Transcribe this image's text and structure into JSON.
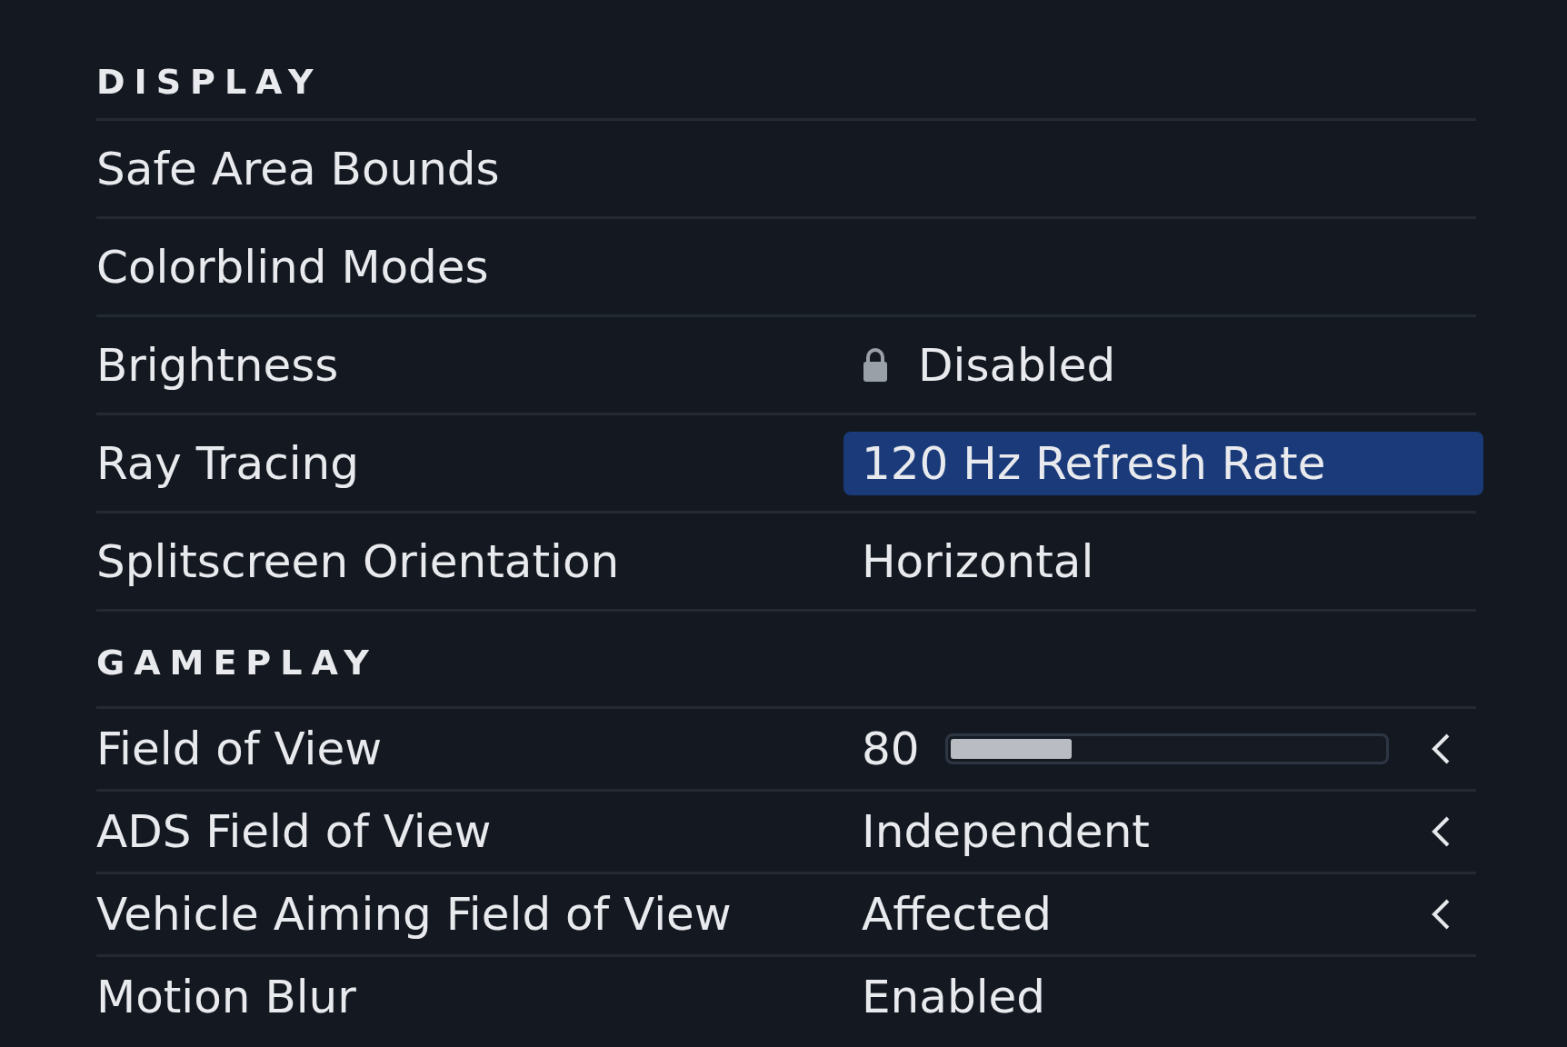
{
  "sections": [
    {
      "title": "DISPLAY",
      "rows": [
        {
          "label": "Safe Area Bounds",
          "kind": "none"
        },
        {
          "label": "Colorblind Modes",
          "kind": "none"
        },
        {
          "label": "Brightness",
          "kind": "text",
          "value": "Disabled",
          "locked": true,
          "selected": false
        },
        {
          "label": "Ray Tracing",
          "kind": "text",
          "value": "120 Hz Refresh Rate",
          "locked": false,
          "selected": true
        },
        {
          "label": "Splitscreen Orientation",
          "kind": "text",
          "value": "Horizontal",
          "locked": false,
          "selected": false
        }
      ]
    },
    {
      "title": "GAMEPLAY",
      "rows": [
        {
          "label": "Field of View",
          "kind": "slider",
          "value": "80",
          "level": 0.28,
          "chevron": true
        },
        {
          "label": "ADS Field of View",
          "kind": "text",
          "value": "Independent",
          "locked": false,
          "selected": false,
          "chevron": true
        },
        {
          "label": "Vehicle Aiming Field of View",
          "kind": "text",
          "value": "Affected",
          "locked": false,
          "selected": false,
          "chevron": true
        },
        {
          "label": "Motion Blur",
          "kind": "text",
          "value": "Enabled",
          "locked": false,
          "selected": false,
          "chevron": false
        }
      ]
    }
  ]
}
